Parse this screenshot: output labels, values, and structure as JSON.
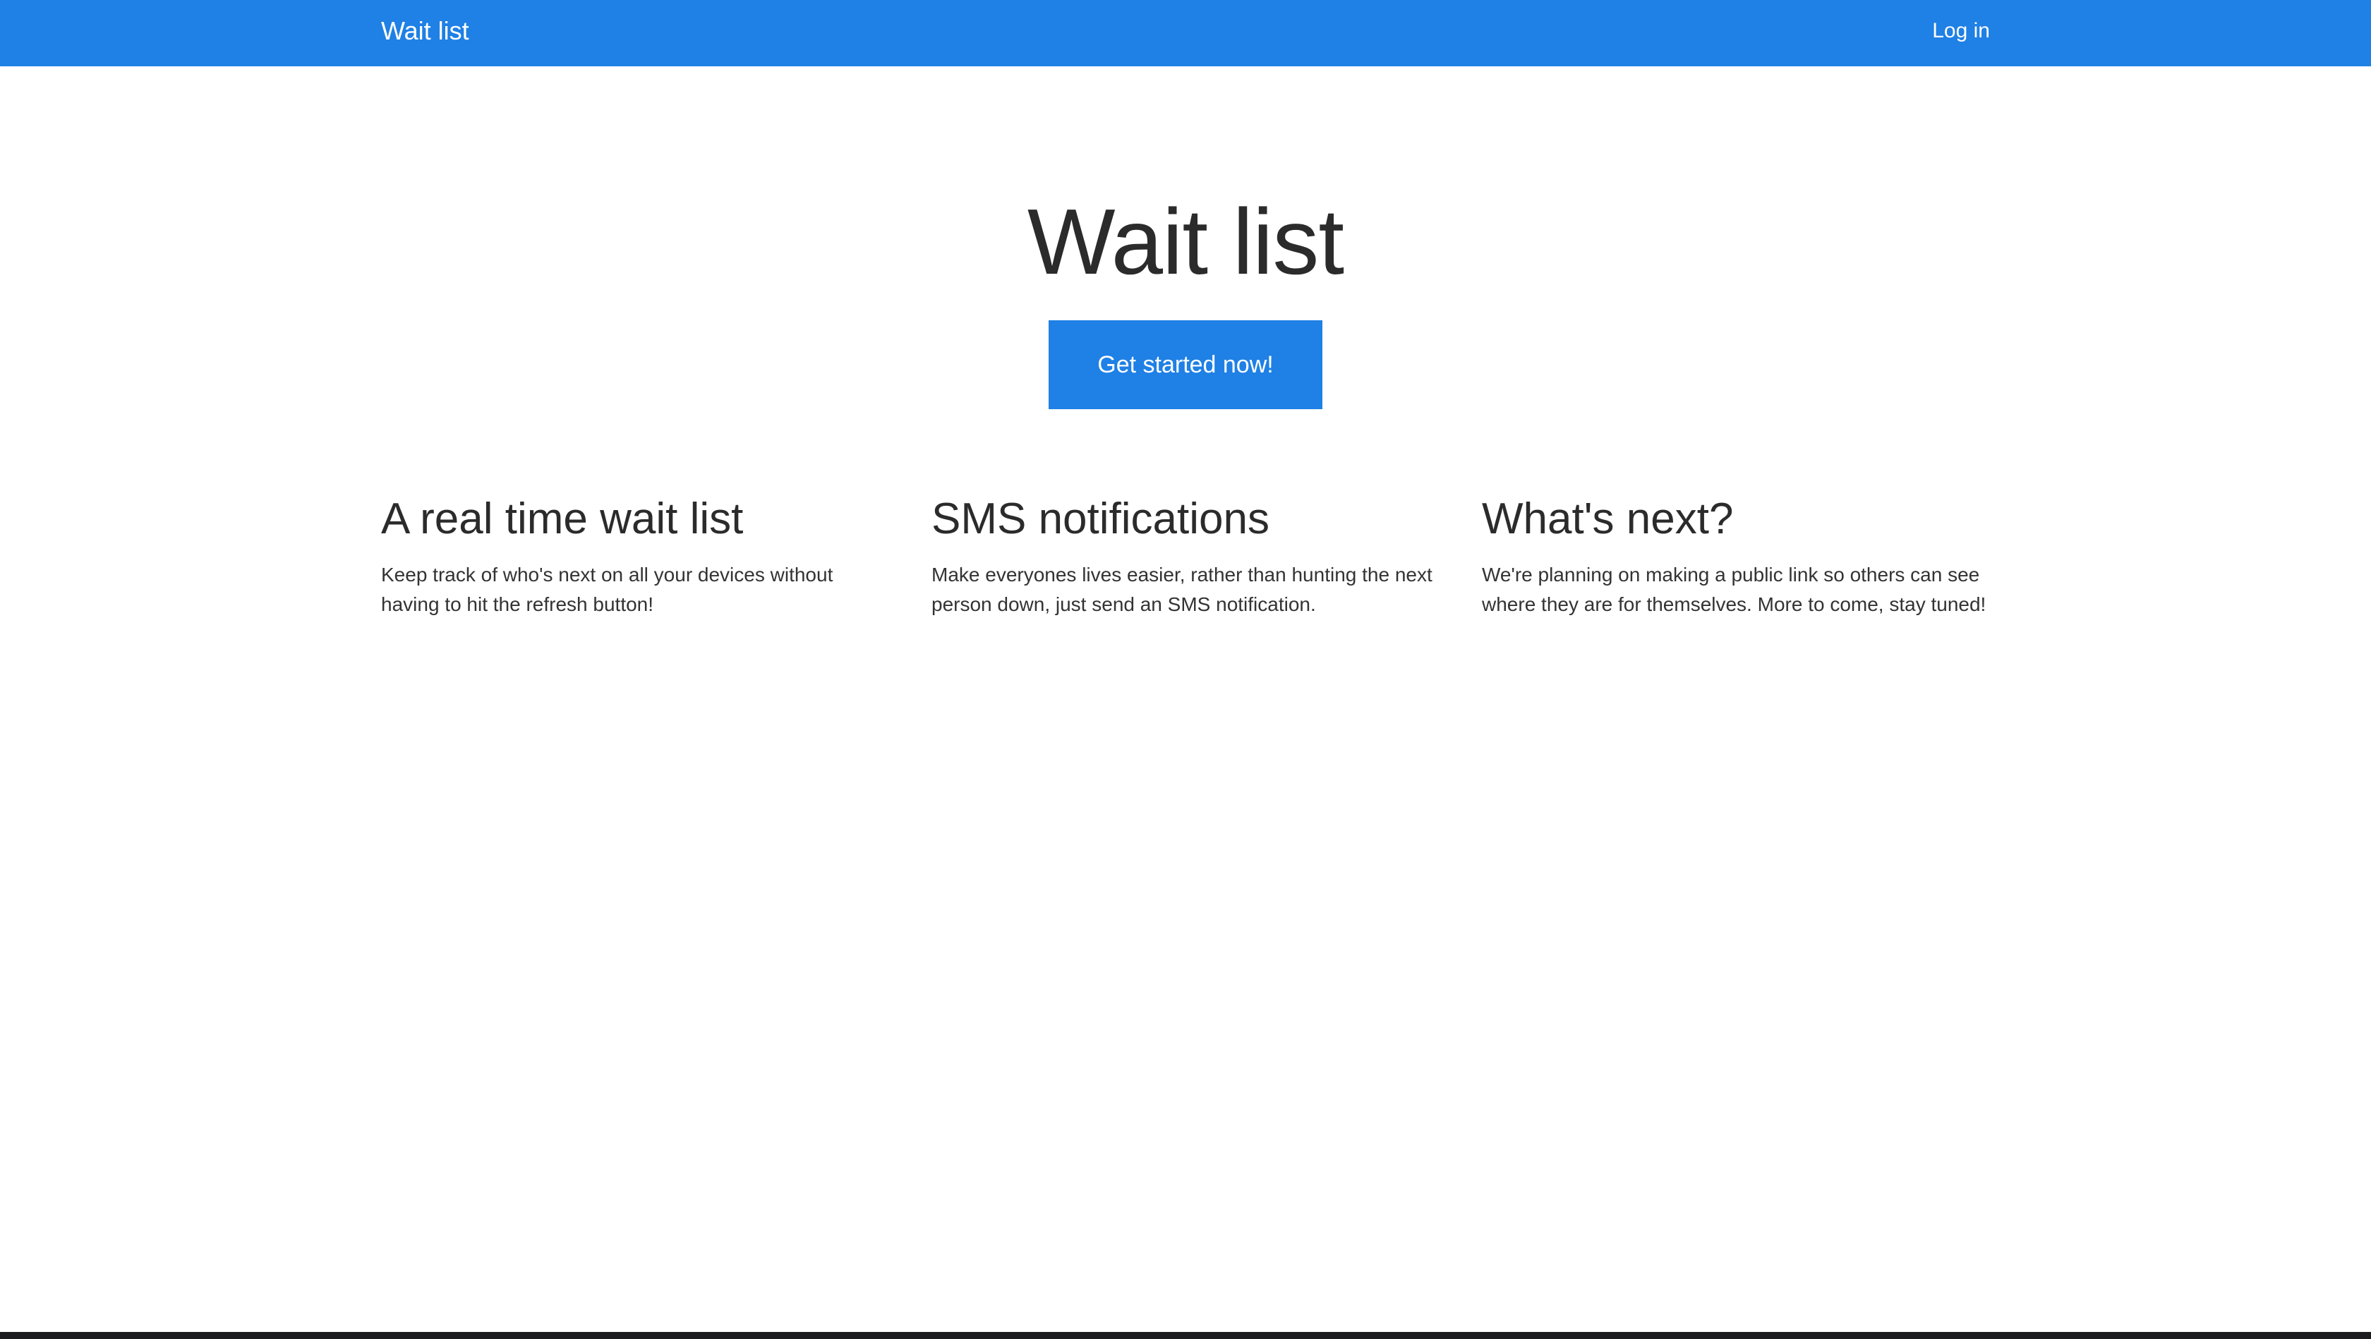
{
  "navbar": {
    "brand": "Wait list",
    "login_label": "Log in",
    "color": "#1f80e5"
  },
  "hero": {
    "title": "Wait list",
    "cta_label": "Get started now!"
  },
  "features": [
    {
      "heading": "A real time wait list",
      "body": "Keep track of who's next on all your devices without having to hit the refresh button!"
    },
    {
      "heading": "SMS notifications",
      "body": "Make everyones lives easier, rather than hunting the next person down, just send an SMS notification."
    },
    {
      "heading": "What's next?",
      "body": "We're planning on making a public link so others can see where they are for themselves. More to come, stay tuned!"
    }
  ]
}
